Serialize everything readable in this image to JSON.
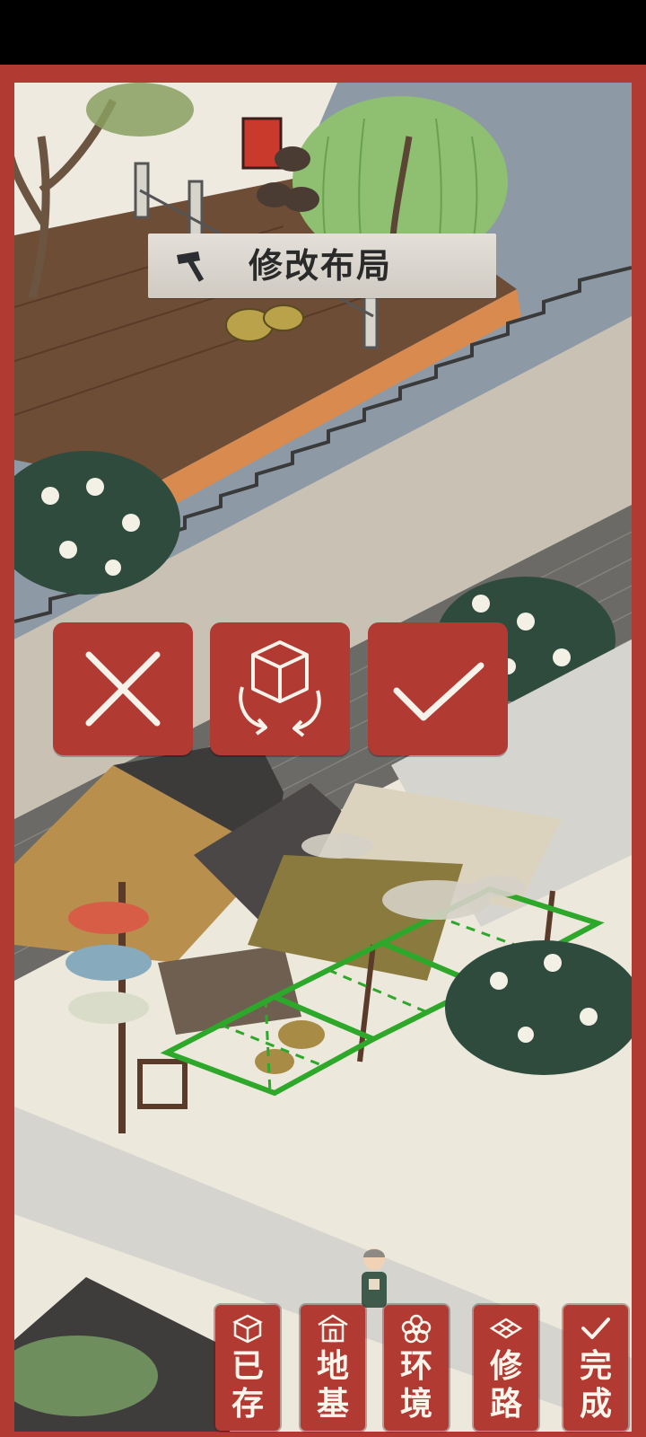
{
  "mode_banner": {
    "label": "修改布局",
    "icon": "hammer-icon"
  },
  "placement_actions": {
    "cancel": {
      "icon": "close-icon"
    },
    "rotate": {
      "icon": "rotate-building-icon"
    },
    "confirm": {
      "icon": "check-icon"
    }
  },
  "toolbar": {
    "saved": {
      "line1": "已",
      "line2": "存",
      "icon": "box-icon"
    },
    "foundation": {
      "line1": "地",
      "line2": "基",
      "icon": "house-icon"
    },
    "environment": {
      "line1": "环",
      "line2": "境",
      "icon": "flower-icon"
    },
    "road": {
      "line1": "修",
      "line2": "路",
      "icon": "road-tile-icon"
    },
    "done": {
      "line1": "完",
      "line2": "成",
      "icon": "check-icon"
    }
  },
  "colors": {
    "frame": "#b13a33",
    "placement_grid": "#2ea82a",
    "paper": "#ece8dc"
  }
}
